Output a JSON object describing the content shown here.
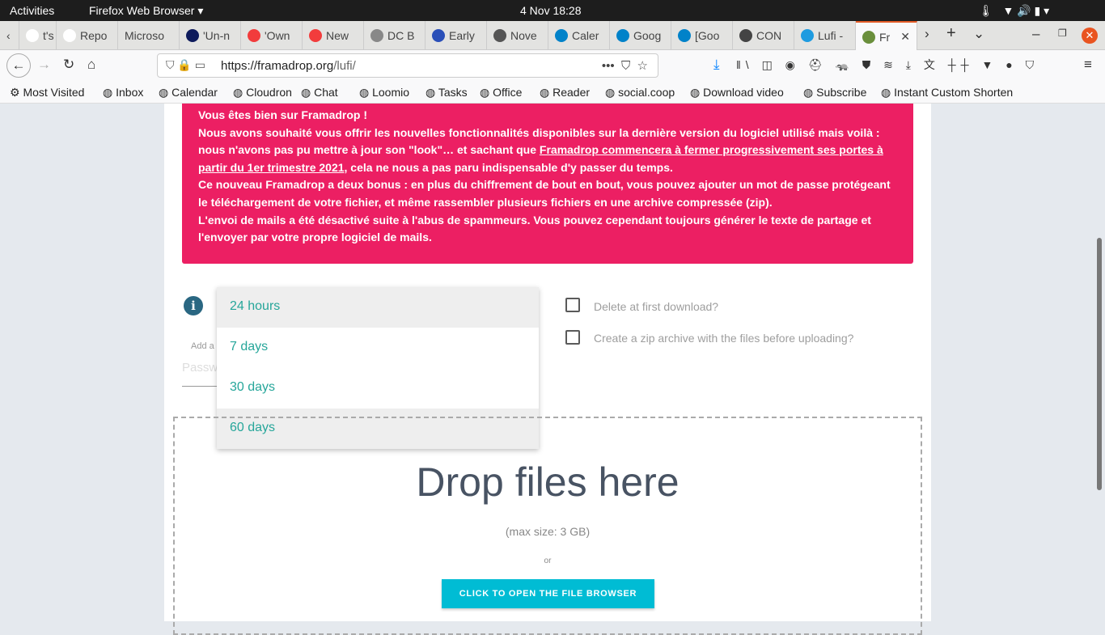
{
  "topbar": {
    "activities": "Activities",
    "app": "Firefox Web Browser ▾",
    "clock": "4 Nov  18:28"
  },
  "tabs": [
    {
      "label": "t's tr",
      "color": "#fff"
    },
    {
      "label": "Repo",
      "color": "#fff"
    },
    {
      "label": "Microso",
      "color": ""
    },
    {
      "label": "'Un-n",
      "color": "#0e1b5c"
    },
    {
      "label": "'Own",
      "color": "#f23c3c"
    },
    {
      "label": "New",
      "color": "#f23c3c"
    },
    {
      "label": "DC B",
      "color": "#888"
    },
    {
      "label": "Early",
      "color": "#2a4fb8"
    },
    {
      "label": "Nove",
      "color": "#555"
    },
    {
      "label": "Caler",
      "color": "#0082c9"
    },
    {
      "label": "Goog",
      "color": "#0082c9"
    },
    {
      "label": "[Goo",
      "color": "#0082c9"
    },
    {
      "label": "CON",
      "color": "#444"
    },
    {
      "label": "Lufi -",
      "color": "#1e9be0"
    },
    {
      "label": "Fr",
      "color": "#6a8f3c"
    }
  ],
  "nav": {
    "url_domain": "https://framadrop.org",
    "url_path": "/lufi/"
  },
  "bookmarks": [
    "Most Visited",
    "Inbox",
    "Calendar",
    "Cloudron",
    "Chat",
    "Loomio",
    "Tasks",
    "Office",
    "Reader",
    "social.coop",
    "Download video",
    "Subscribe",
    "Instant Custom Shorten"
  ],
  "alert": {
    "l1": "Vous êtes bien sur Framadrop !",
    "l2a": "Nous avons souhaité vous offrir les nouvelles fonctionnalités disponibles sur la dernière version du logiciel utilisé mais voilà : nous n'avons pas pu mettre à jour son \"look\"… et sachant que ",
    "link": "Framadrop commencera à fermer progressivement ses portes à partir du 1er trimestre 2021",
    "l2b": ", cela ne nous a pas paru indispensable d'y passer du temps.",
    "l3": "Ce nouveau Framadrop a deux bonus : en plus du chiffrement de bout en bout, vous pouvez ajouter un mot de passe protégeant le téléchargement de votre fichier, et même rassembler plusieurs fichiers en une archive compressée (zip).",
    "l4": "L'envoi de mails a été désactivé suite à l'abus de spammeurs. Vous pouvez cependant toujours générer le texte de partage et l'envoyer par votre propre logiciel de mails."
  },
  "form": {
    "add_label": "Add a",
    "password_placeholder": "Passw",
    "delay_options": [
      "24 hours",
      "7 days",
      "30 days",
      "60 days"
    ],
    "delete_first": "Delete at first download?",
    "zip": "Create a zip archive with the files before uploading?"
  },
  "drop": {
    "title": "Drop files here",
    "max": "(max size: 3 GB)",
    "or": "or",
    "button": "CLICK TO OPEN THE FILE BROWSER"
  }
}
